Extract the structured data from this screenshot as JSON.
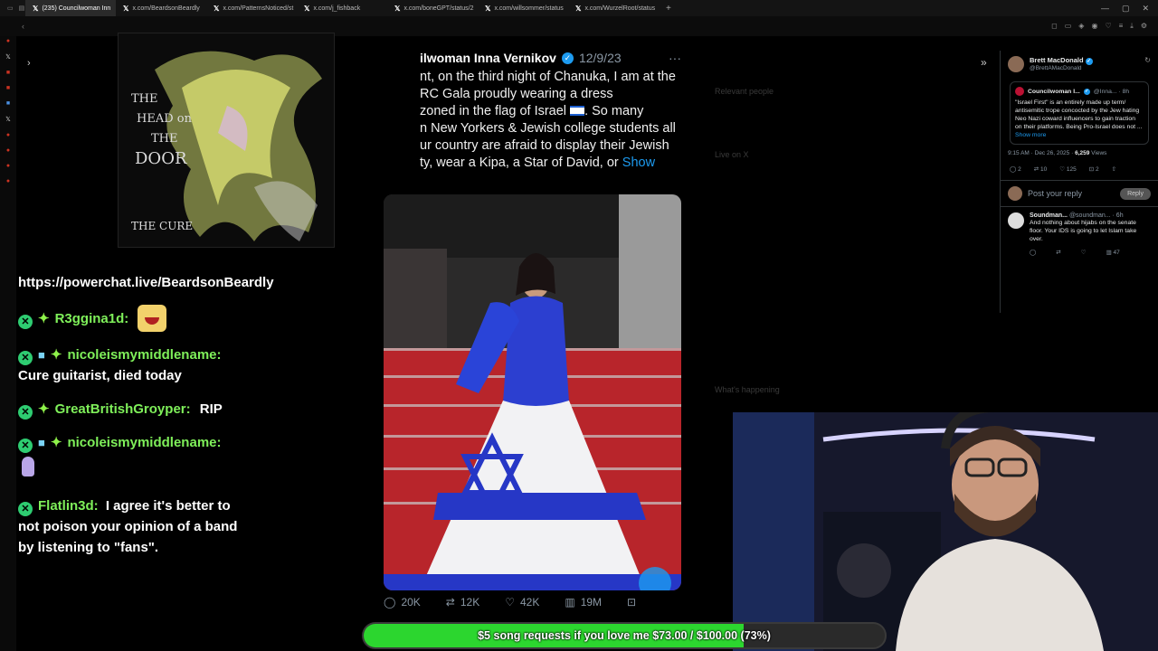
{
  "browser": {
    "tabs": [
      {
        "label": "(235) Councilwoman Inn",
        "active": true
      },
      {
        "label": "x.com/BeardsonBeardly",
        "active": false
      },
      {
        "label": "x.com/PatternsNoticed/st",
        "active": false
      },
      {
        "label": "x.com/j_fishback",
        "active": false
      },
      {
        "label": "x.com/boneGPT/status/2",
        "active": false
      },
      {
        "label": "x.com/willsommer/status",
        "active": false
      },
      {
        "label": "x.com/WurzelRoot/status",
        "active": false
      }
    ],
    "new_tab": "+",
    "tab_icon": "x-logo-icon"
  },
  "album": {
    "title_lines": [
      "THE",
      "HEAD on",
      "THE",
      "DOOR"
    ],
    "band": "THE CURE"
  },
  "chat": {
    "link": "https://powerchat.live/BeardsonBeardly",
    "messages": [
      {
        "user": "R3gginа1d:",
        "text": "",
        "gift": false,
        "emote": "laughing-emote"
      },
      {
        "user": "nicoleismymiddlename:",
        "text": "Cure guitarist, died today",
        "gift": true
      },
      {
        "user": "GreatBritishGroyper:",
        "text": "RIP",
        "gift": false
      },
      {
        "user": "nicoleismymiddlename:",
        "text": "",
        "gift": true,
        "emote": "figure-emote"
      },
      {
        "user": "Flatlin3d:",
        "text": "I agree it's better to not poison your opinion of a band by listening to \"fans\".",
        "gift": false
      }
    ]
  },
  "tweet": {
    "name": "ilwoman Inna Vernikov",
    "date": "12/9/23",
    "more": "···",
    "lines": [
      "nt, on the third night of Chanuka, I am at the",
      "RC Gala proudly wearing a dress",
      "zoned in the flag of Israel",
      ". So many",
      "n New Yorkers & Jewish college students all",
      "ur country are afraid to display their Jewish",
      "ty, wear a Kipa, a Star of David, or"
    ],
    "show": "Show",
    "stats": {
      "replies": "20K",
      "reposts": "12K",
      "likes": "42K",
      "views": "19M"
    }
  },
  "right_panel": {
    "author": "Brett MacDonald",
    "handle": "@BrettAMacDonald",
    "quote": {
      "author": "Councilwoman I...",
      "handle": "@Inna... · 8h",
      "text": "\"Israel First\" is an entirely made up term/ antisemitic trope concocted by the Jew hating Neo Nazi coward influencers to gain traction on their platforms. Being Pro-Israel does not ...",
      "more": "Show more"
    },
    "time": "9:15 AM · Dec 26, 2025 ·",
    "views_count": "6,259",
    "views_label": "Views",
    "stats": {
      "replies": "2",
      "reposts": "10",
      "likes": "125",
      "bookmarks": "2"
    },
    "reply_placeholder": "Post your reply",
    "reply_button": "Reply",
    "reply": {
      "author": "Soundman...",
      "handle": "@soundman... · 6h",
      "text": "And nothing about hijabs on the senate floor. Your IDS is going to let Islam take over.",
      "views": "47"
    }
  },
  "faint_column": {
    "items": [
      "Relevant people",
      "Live on X",
      "What's happening"
    ]
  },
  "goal": {
    "text": "$5 song requests if you love me $73.00 / $100.00 (73%)",
    "progress": 0.73
  },
  "colors": {
    "accent": "#1d9bf0",
    "goal_fill": "#2cd62f",
    "chat_user": "#7ff05a"
  }
}
